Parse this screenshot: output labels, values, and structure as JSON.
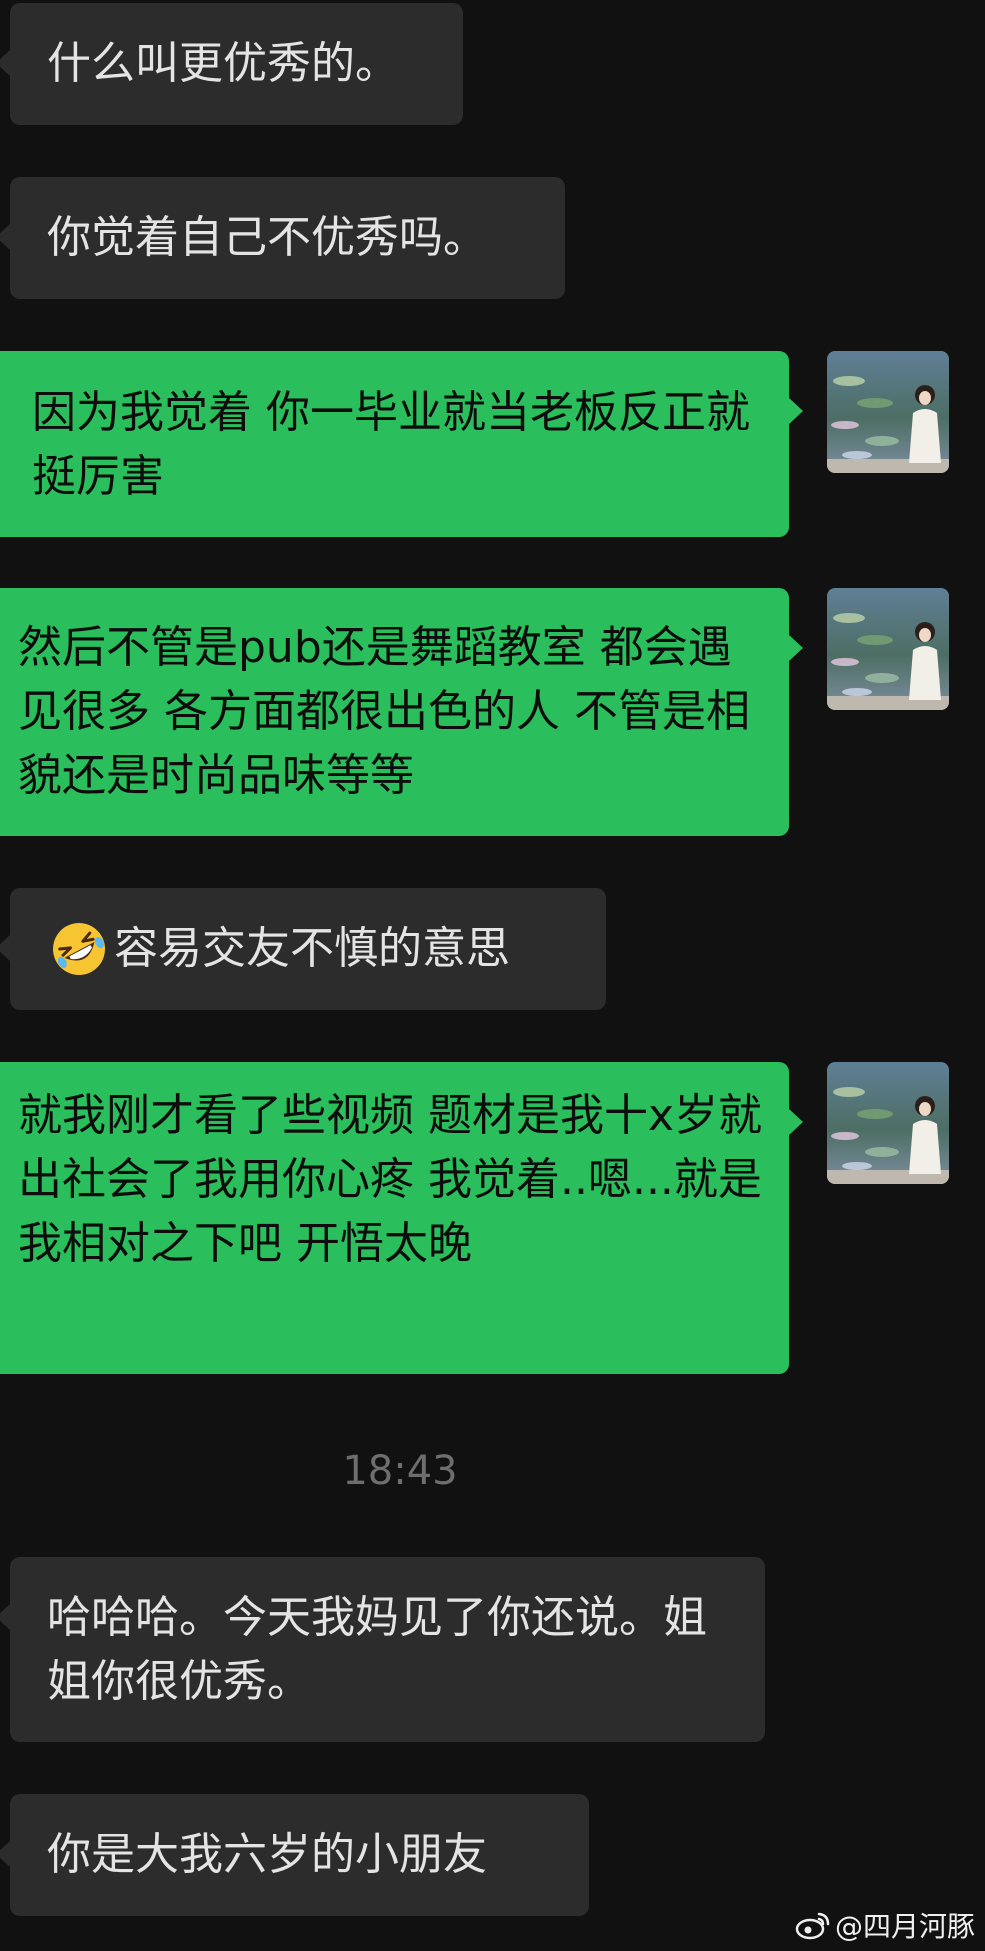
{
  "messages": [
    {
      "sender": "other",
      "text": "什么叫更优秀的。"
    },
    {
      "sender": "other",
      "text": "你觉着自己不优秀吗。"
    },
    {
      "sender": "me",
      "text": "因为我觉着 你一毕业就当老板反正就 挺厉害"
    },
    {
      "sender": "me",
      "text": "然后不管是pub还是舞蹈教室 都会遇见很多 各方面都很出色的人 不管是相貌还是时尚品味等等"
    },
    {
      "sender": "other",
      "emoji": "rolling-on-floor-laughing",
      "text": "容易交友不慎的意思"
    },
    {
      "sender": "me",
      "text": "就我刚才看了些视频 题材是我十x岁就出社会了我用你心疼 我觉着..嗯...就是我相对之下吧 开悟太晚"
    },
    {
      "sender": "other",
      "text": "哈哈哈。今天我妈见了你还说。姐姐你很优秀。"
    },
    {
      "sender": "other",
      "text": "你是大我六岁的小朋友"
    }
  ],
  "timestamp": "18:43",
  "watermark": "@四月河豚",
  "colors": {
    "background": "#111111",
    "received_bubble": "#2c2c2c",
    "sent_bubble": "#2bbe5c",
    "timestamp": "#6e6e6e"
  }
}
